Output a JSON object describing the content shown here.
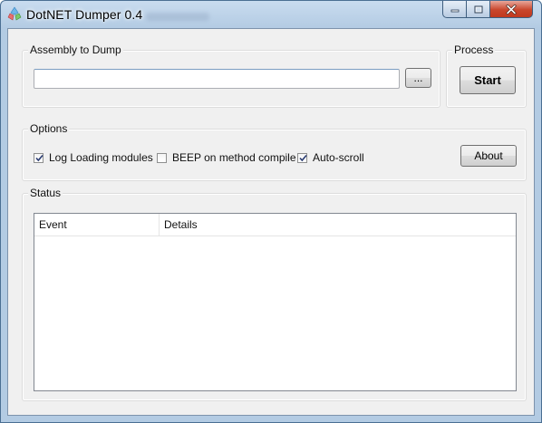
{
  "window": {
    "title": "DotNET Dumper 0.4"
  },
  "assembly": {
    "label": "Assembly to Dump",
    "path_value": "",
    "browse_label": "..."
  },
  "process": {
    "label": "Process",
    "start_label": "Start"
  },
  "options": {
    "label": "Options",
    "log_loading": {
      "label": "Log Loading modules",
      "checked": true
    },
    "beep": {
      "label": "BEEP on method compile",
      "checked": false
    },
    "autoscroll": {
      "label": "Auto-scroll",
      "checked": true
    },
    "about_label": "About"
  },
  "status": {
    "label": "Status",
    "columns": [
      "Event",
      "Details"
    ],
    "rows": []
  }
}
